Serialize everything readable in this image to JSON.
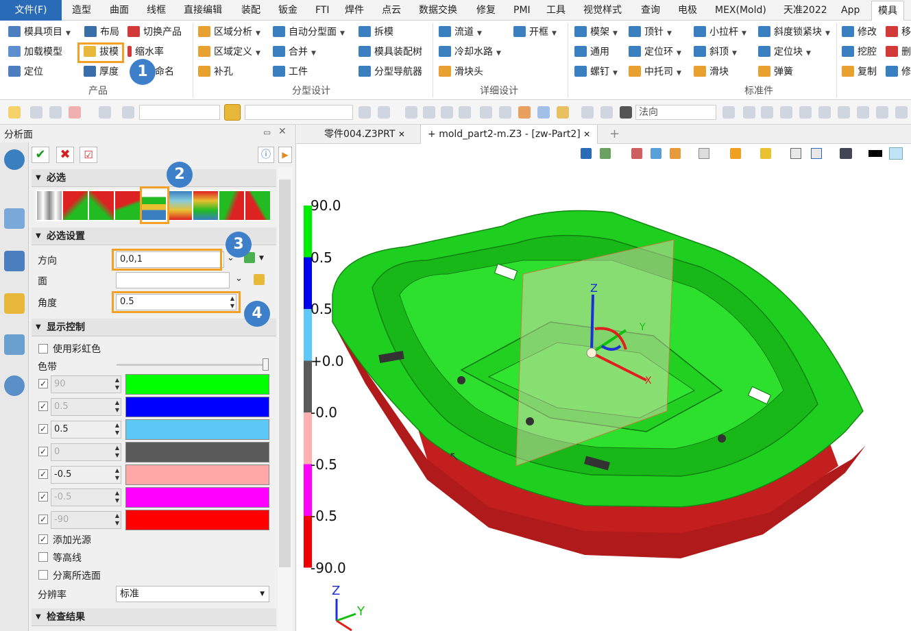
{
  "menubar": {
    "file": "文件(F)",
    "tabs": [
      "造型",
      "曲面",
      "线框",
      "直接编辑",
      "装配",
      "钣金",
      "FTI",
      "焊件",
      "点云",
      "数据交换",
      "修复",
      "PMI",
      "工具",
      "视觉样式",
      "查询",
      "电极",
      "MEX(Mold)",
      "天准2022",
      "App"
    ],
    "active": "模具"
  },
  "ribbon": {
    "product": {
      "items": [
        "模具项目",
        "布局",
        "切换产品",
        "加载模型",
        "拔模",
        "缩水率",
        "定位",
        "厚度",
        "命名"
      ],
      "label": "产品"
    },
    "parting": {
      "items": [
        "区域分析",
        "自动分型面",
        "拆模",
        "区域定义",
        "合并",
        "模具装配树",
        "补孔",
        "工件",
        "分型导航器"
      ],
      "label": "分型设计"
    },
    "detail": {
      "items": [
        "流道",
        "开框",
        "冷却水路",
        "滑块头"
      ],
      "label": "详细设计"
    },
    "standard": {
      "items": [
        "模架",
        "顶针",
        "小拉杆",
        "斜度锁紧块",
        "通用",
        "定位环",
        "斜顶",
        "定位块",
        "螺钉",
        "中托司",
        "滑块",
        "弹簧"
      ],
      "label": "标准件"
    },
    "edit": {
      "items": [
        "修改",
        "移",
        "挖腔",
        "删",
        "复制",
        "修"
      ]
    }
  },
  "toolbar2": {
    "view_select": "法向"
  },
  "panel": {
    "title": "分析面",
    "sections": {
      "required": "必选",
      "required_settings": "必选设置",
      "display": "显示控制",
      "results": "检查结果"
    },
    "direction_label": "方向",
    "direction_value": "0,0,1",
    "face_label": "面",
    "face_value": "",
    "angle_label": "角度",
    "angle_value": "0.5",
    "rainbow_label": "使用彩虹色",
    "band_label": "色带",
    "bands": [
      {
        "value": "90",
        "color": "#00ff00",
        "editable": false
      },
      {
        "value": "0.5",
        "color": "#0000ff",
        "editable": false
      },
      {
        "value": "0.5",
        "color": "#5ec8f8",
        "editable": true
      },
      {
        "value": "0",
        "color": "#5a5a5a",
        "editable": false
      },
      {
        "value": "-0.5",
        "color": "#ffa8a8",
        "editable": true
      },
      {
        "value": "-0.5",
        "color": "#ff00ff",
        "editable": false
      },
      {
        "value": "-90",
        "color": "#ff0000",
        "editable": false
      }
    ],
    "light_label": "添加光源",
    "contour_label": "等高线",
    "isolate_label": "分离所选面",
    "resolution_label": "分辨率",
    "resolution_value": "标准"
  },
  "tabs": [
    "零件004.Z3PRT",
    "mold_part2-m.Z3 - [zw-Part2]"
  ],
  "callouts": [
    "1",
    "2",
    "3",
    "4"
  ],
  "legend": {
    "labels": [
      "90.0",
      "0.5",
      "0.5",
      "+0.0",
      "-0.0",
      "-0.5",
      "-0.5",
      "-90.0"
    ],
    "colors": [
      "#00ee00",
      "#0000ee",
      "#5ec8f8",
      "#5a5a5a",
      "#ffb0b0",
      "#ff00ff",
      "#ee0000"
    ]
  },
  "triad": {
    "z": "Z",
    "y": "Y",
    "x": "X"
  }
}
